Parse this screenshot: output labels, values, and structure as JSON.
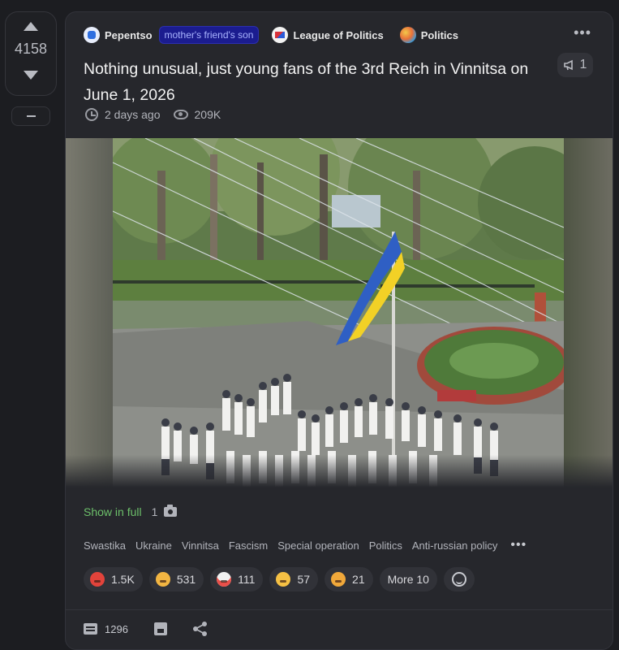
{
  "vote": {
    "count": "4158"
  },
  "post": {
    "header": {
      "community": "Pepentso",
      "flair": "mother's friend's son",
      "tags_inline": [
        {
          "label": "League of Politics"
        },
        {
          "label": "Politics"
        }
      ]
    },
    "title": "Nothing unusual, just young fans of the 3rd Reich in Vinnitsa on June 1, 2026",
    "promo_count": "1",
    "meta": {
      "time": "2 days ago",
      "views": "209K"
    },
    "media": {
      "show_full_label": "Show in full",
      "photo_count": "1"
    },
    "tags": [
      "Swastika",
      "Ukraine",
      "Vinnitsa",
      "Fascism",
      "Special operation",
      "Politics",
      "Anti-russian policy"
    ],
    "reactions": [
      {
        "emoji": "angry-face",
        "count": "1.5K"
      },
      {
        "emoji": "thinking-face",
        "count": "531"
      },
      {
        "emoji": "clown-face",
        "count": "111"
      },
      {
        "emoji": "laughing-face",
        "count": "57"
      },
      {
        "emoji": "astonished-face",
        "count": "21"
      }
    ],
    "reactions_more": "More 10",
    "footer": {
      "comments": "1296"
    }
  },
  "colors": {
    "background": "#1c1d21",
    "card": "#26272c",
    "flair_bg": "#1b1c8f",
    "show_full_link": "#6cbf6a",
    "flag_blue": "#2f5fc4",
    "flag_yellow": "#f2d126"
  }
}
